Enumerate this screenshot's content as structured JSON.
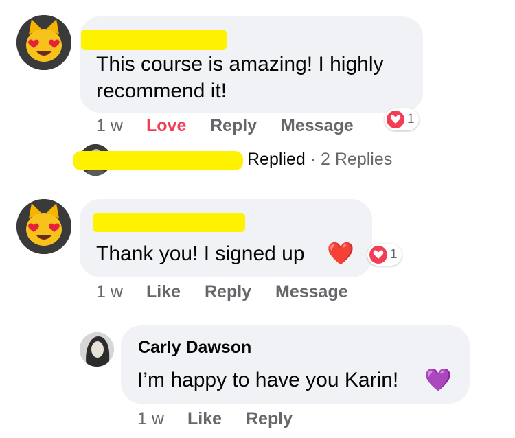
{
  "comments": [
    {
      "author": "",
      "text_line1": "This course is amazing! I highly",
      "text_line2": "recommend it!",
      "time": "1 w",
      "reaction_action": "Love",
      "reply_action": "Reply",
      "message_action": "Message",
      "reaction_count": "1",
      "reaction_icon": "heart-icon",
      "replies_summary": {
        "replied_text": "Replied",
        "separator": "·",
        "count_text": "2 Replies"
      }
    },
    {
      "author": "",
      "text": "Thank you! I signed up",
      "emoji": "❤️",
      "time": "1 w",
      "like_action": "Like",
      "reply_action": "Reply",
      "message_action": "Message",
      "reaction_count": "1",
      "reaction_icon": "heart-icon"
    }
  ],
  "reply": {
    "author": "Carly Dawson",
    "text": "I’m happy to have you Karin!",
    "emoji": "💜",
    "time": "1 w",
    "like_action": "Like",
    "reply_action": "Reply"
  },
  "colors": {
    "bubble": "#f0f2f5",
    "muted": "#65676b",
    "love": "#f33e58",
    "redaction": "#fff200"
  }
}
